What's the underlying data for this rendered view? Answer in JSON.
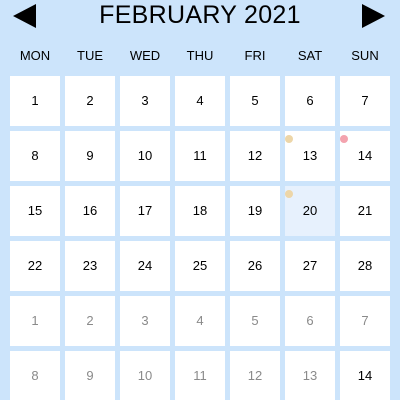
{
  "header": {
    "title": "FEBRUARY 2021",
    "prev_icon": "triangle-left",
    "next_icon": "triangle-right"
  },
  "weekdays": [
    "MON",
    "TUE",
    "WED",
    "THU",
    "FRI",
    "SAT",
    "SUN"
  ],
  "colors": {
    "background": "#cce4fb",
    "cell": "#ffffff",
    "selected_cell": "#e7f1fd",
    "muted_text": "#8a8a8a",
    "dot_yellow": "#edd6a8",
    "dot_pink": "#f4a3ae"
  },
  "weeks": [
    [
      {
        "day": "1"
      },
      {
        "day": "2"
      },
      {
        "day": "3"
      },
      {
        "day": "4"
      },
      {
        "day": "5"
      },
      {
        "day": "6"
      },
      {
        "day": "7"
      }
    ],
    [
      {
        "day": "8"
      },
      {
        "day": "9"
      },
      {
        "day": "10"
      },
      {
        "day": "11"
      },
      {
        "day": "12"
      },
      {
        "day": "13",
        "dot": "yellow"
      },
      {
        "day": "14",
        "dot": "pink"
      }
    ],
    [
      {
        "day": "15"
      },
      {
        "day": "16"
      },
      {
        "day": "17"
      },
      {
        "day": "18"
      },
      {
        "day": "19"
      },
      {
        "day": "20",
        "dot": "yellow",
        "selected": true
      },
      {
        "day": "21"
      }
    ],
    [
      {
        "day": "22"
      },
      {
        "day": "23"
      },
      {
        "day": "24"
      },
      {
        "day": "25"
      },
      {
        "day": "26"
      },
      {
        "day": "27"
      },
      {
        "day": "28"
      }
    ],
    [
      {
        "day": "1",
        "muted": true
      },
      {
        "day": "2",
        "muted": true
      },
      {
        "day": "3",
        "muted": true
      },
      {
        "day": "4",
        "muted": true
      },
      {
        "day": "5",
        "muted": true
      },
      {
        "day": "6",
        "muted": true
      },
      {
        "day": "7",
        "muted": true
      }
    ],
    [
      {
        "day": "8",
        "muted": true
      },
      {
        "day": "9",
        "muted": true
      },
      {
        "day": "10",
        "muted": true
      },
      {
        "day": "11",
        "muted": true
      },
      {
        "day": "12",
        "muted": true
      },
      {
        "day": "13",
        "muted": true
      },
      {
        "day": "14"
      }
    ]
  ]
}
